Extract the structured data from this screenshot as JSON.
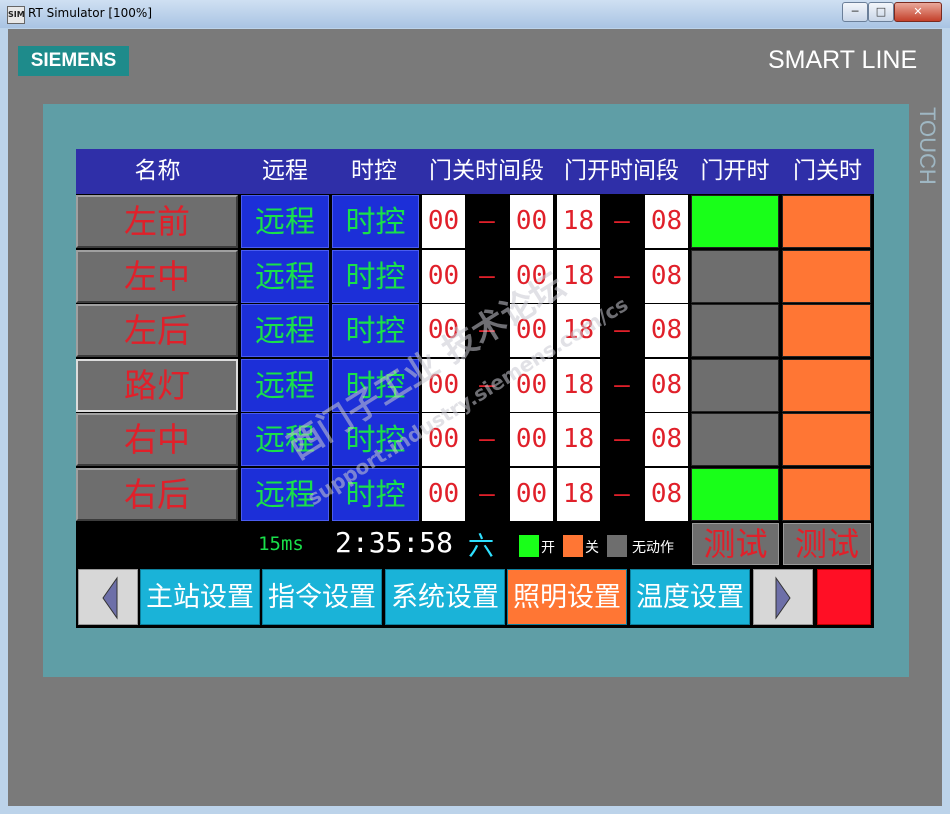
{
  "window": {
    "title": "RT Simulator [100%]",
    "icon": "siemens-app-icon",
    "icon_text": "SIM"
  },
  "controls": {
    "min": "─",
    "max": "□",
    "close": "✕"
  },
  "panel": {
    "brand": "SIEMENS",
    "model": "SMART LINE",
    "touch": "TOUCH"
  },
  "header": [
    "名称",
    "远程",
    "时控",
    "门关时间段",
    "门开时间段",
    "门开时",
    "门关时"
  ],
  "rows": [
    {
      "name": "左前",
      "remote": "远程",
      "timer": "时控",
      "close_start": "00",
      "close_end": "00",
      "open_start": "18",
      "open_end": "08",
      "open_state": "开",
      "close_state": "关"
    },
    {
      "name": "左中",
      "remote": "远程",
      "timer": "时控",
      "close_start": "00",
      "close_end": "00",
      "open_start": "18",
      "open_end": "08",
      "open_state": "无动作",
      "close_state": "关"
    },
    {
      "name": "左后",
      "remote": "远程",
      "timer": "时控",
      "close_start": "00",
      "close_end": "00",
      "open_start": "18",
      "open_end": "08",
      "open_state": "无动作",
      "close_state": "关"
    },
    {
      "name": "路灯",
      "remote": "远程",
      "timer": "时控",
      "close_start": "00",
      "close_end": "00",
      "open_start": "18",
      "open_end": "08",
      "open_state": "无动作",
      "close_state": "关"
    },
    {
      "name": "右中",
      "remote": "远程",
      "timer": "时控",
      "close_start": "00",
      "close_end": "00",
      "open_start": "18",
      "open_end": "08",
      "open_state": "无动作",
      "close_state": "关"
    },
    {
      "name": "右后",
      "remote": "远程",
      "timer": "时控",
      "close_start": "00",
      "close_end": "00",
      "open_start": "18",
      "open_end": "08",
      "open_state": "开",
      "close_state": "关"
    }
  ],
  "dash": "–",
  "status": {
    "cycle": "15ms",
    "time": "2:35:58",
    "weekday": "六"
  },
  "legend": [
    {
      "label": "开",
      "color": "#19ff19"
    },
    {
      "label": "关",
      "color": "#ff7634"
    },
    {
      "label": "无动作",
      "color": "#6e6e6e"
    }
  ],
  "test_buttons": [
    "测试",
    "测试"
  ],
  "nav": [
    "主站设置",
    "指令设置",
    "系统设置",
    "照明设置",
    "温度设置"
  ],
  "nav_active": "照明设置",
  "watermark": {
    "line1": "西门子工业 技术论坛",
    "line2": "support.industry.siemens.com/cs"
  },
  "colors": {
    "header_bg": "#2f2fa8",
    "on": "#19ff19",
    "off": "#ff7634",
    "idle": "#6e6e6e",
    "nav": "#1ab3d8",
    "alarm": "#ff0f25"
  }
}
